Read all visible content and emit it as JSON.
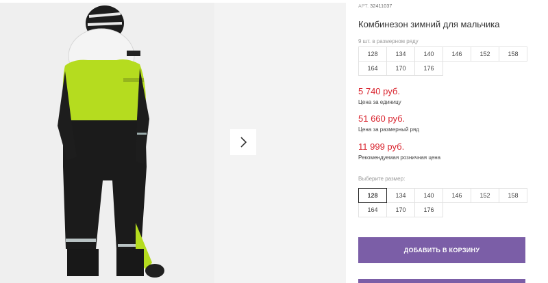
{
  "product": {
    "sku_label": "АРТ.",
    "sku_value": "32411037",
    "title": "Комбинезон зимний для мальчика",
    "pack_note": "9 шт. в размерном ряду",
    "pack_sizes": [
      "128",
      "134",
      "140",
      "146",
      "152",
      "158",
      "164",
      "170",
      "176"
    ]
  },
  "prices": {
    "unit_price": "5 740 руб.",
    "unit_label": "Цена за единицу",
    "row_price": "51 660 руб.",
    "row_label": "Цена за размерный ряд",
    "retail_price": "11 999 руб.",
    "retail_label": "Рекомендуемая розничная цена"
  },
  "size_picker": {
    "label": "Выберите размер:",
    "options": [
      "128",
      "134",
      "140",
      "146",
      "152",
      "158",
      "164",
      "170",
      "176"
    ],
    "selected": "128"
  },
  "cart": {
    "add_label": "ДОБАВИТЬ В КОРЗИНУ"
  },
  "colors": {
    "accent": "#7b5ea7",
    "price": "#d9232d"
  },
  "icons": {
    "gallery_next": "chevron-right-icon"
  }
}
